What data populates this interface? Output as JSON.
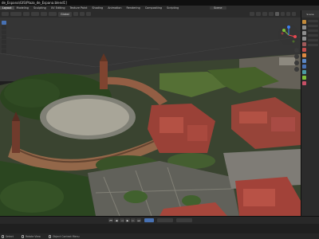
{
  "window": {
    "title": "de_Espana\\GIS\\Plaza_de_Espana.blend1]"
  },
  "menu": {
    "items": [
      {
        "label": "Layout",
        "active": true
      },
      {
        "label": "Modeling",
        "active": false
      },
      {
        "label": "Sculpting",
        "active": false
      },
      {
        "label": "UV Editing",
        "active": false
      },
      {
        "label": "Texture Paint",
        "active": false
      },
      {
        "label": "Shading",
        "active": false
      },
      {
        "label": "Animation",
        "active": false
      },
      {
        "label": "Rendering",
        "active": false
      },
      {
        "label": "Compositing",
        "active": false
      },
      {
        "label": "Scripting",
        "active": false
      }
    ],
    "scene_label": "Scene"
  },
  "viewport_header": {
    "transform_orientation": "Global"
  },
  "properties": {
    "header_label": "Scene"
  },
  "status_bar": {
    "items": [
      {
        "label": "Select"
      },
      {
        "label": "Rotate View"
      },
      {
        "label": "Object Context Menu"
      }
    ]
  },
  "colors": {
    "active_tab": "#4771b3",
    "gizmo_x": "#e8474f",
    "gizmo_y": "#7fc03a",
    "gizmo_z": "#3d7ff0"
  }
}
